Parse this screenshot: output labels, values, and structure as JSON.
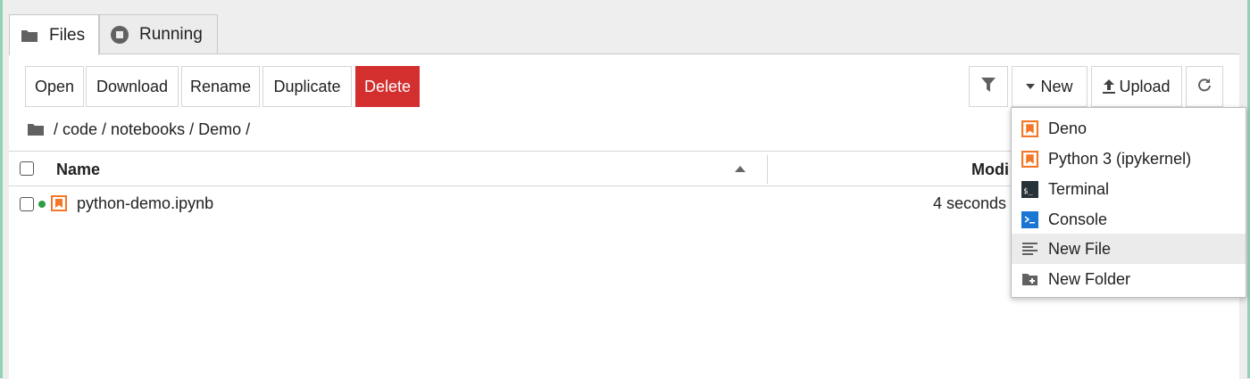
{
  "tabs": [
    {
      "label": "Files"
    },
    {
      "label": "Running"
    }
  ],
  "toolbar": {
    "open": "Open",
    "download": "Download",
    "rename": "Rename",
    "duplicate": "Duplicate",
    "delete": "Delete",
    "new": "New",
    "upload": "Upload"
  },
  "breadcrumb": {
    "text": "/ code / notebooks / Demo /"
  },
  "table": {
    "col_name": "Name",
    "col_modified": "Modi",
    "rows": [
      {
        "name": "python-demo.ipynb",
        "modified": "4 seconds",
        "running": true
      }
    ]
  },
  "new_menu": {
    "items": [
      {
        "label": "Deno",
        "icon": "notebook-icon"
      },
      {
        "label": "Python 3 (ipykernel)",
        "icon": "notebook-icon"
      },
      {
        "label": "Terminal",
        "icon": "terminal-icon"
      },
      {
        "label": "Console",
        "icon": "console-icon"
      },
      {
        "label": "New File",
        "icon": "text-file-icon"
      },
      {
        "label": "New Folder",
        "icon": "new-folder-icon"
      }
    ],
    "hovered_index": 4
  },
  "colors": {
    "delete_red": "#d32f2f",
    "notebook_orange": "#f37726",
    "console_blue": "#1976d2",
    "running_green": "#2e9e46",
    "accent_edge": "#8fd3b4"
  }
}
